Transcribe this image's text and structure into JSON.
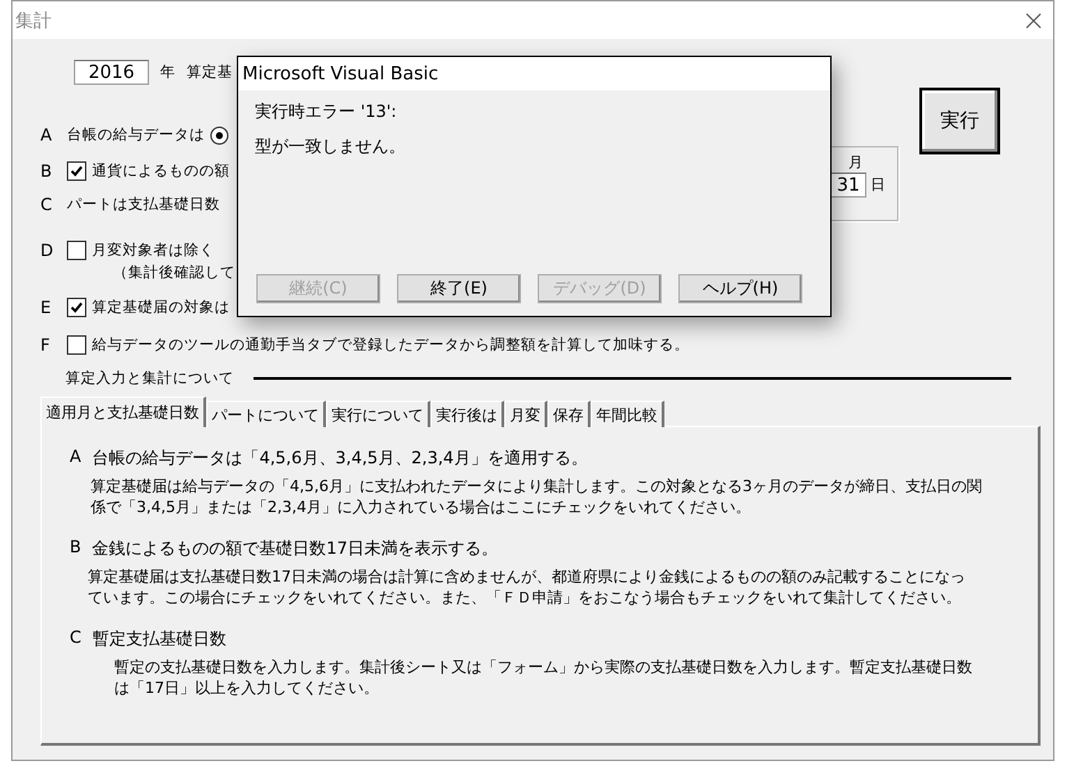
{
  "window": {
    "title": "集計"
  },
  "form": {
    "year": "2016",
    "year_label": "年",
    "base_label": "算定基",
    "execute": "実行",
    "options": [
      {
        "letter": "A",
        "kind": "radio",
        "label": "台帳の給与データは",
        "selected": true
      },
      {
        "letter": "B",
        "kind": "checkbox",
        "label": "通貨によるものの額",
        "checked": true
      },
      {
        "letter": "C",
        "kind": "text",
        "label": "パートは支払基礎日数"
      },
      {
        "letter": "D",
        "kind": "checkbox",
        "label": "月変対象者は除く",
        "checked": false,
        "note": "（集計後確認して"
      },
      {
        "letter": "E",
        "kind": "checkbox",
        "label": "算定基礎届の対象は",
        "checked": true
      },
      {
        "letter": "F",
        "kind": "checkbox",
        "label": "給与データのツールの通勤手当タブで登録したデータから調整額を計算して加味する。",
        "checked": false
      }
    ],
    "group": {
      "month": "月",
      "day": "31",
      "day_unit": "日"
    }
  },
  "section": {
    "title": "算定入力と集計について"
  },
  "tabs": [
    {
      "label": "適用月と支払基礎日数",
      "selected": true
    },
    {
      "label": "パートについて",
      "selected": false
    },
    {
      "label": "実行について",
      "selected": false
    },
    {
      "label": "実行後は",
      "selected": false
    },
    {
      "label": "月変",
      "selected": false
    },
    {
      "label": "保存",
      "selected": false
    },
    {
      "label": "年間比較",
      "selected": false
    }
  ],
  "panel": [
    {
      "letter": "A",
      "heading": "台帳の給与データは「4,5,6月、3,4,5月、2,3,4月」を適用する。",
      "body": "算定基礎届は給与データの「4,5,6月」に支払われたデータにより集計します。この対象となる3ヶ月のデータが締日、支払日の関係で「3,4,5月」または「2,3,4月」に入力されている場合はここにチェックをいれてください。"
    },
    {
      "letter": "B",
      "heading": "金銭によるものの額で基礎日数17日未満を表示する。",
      "body": "算定基礎届は支払基礎日数17日未満の場合は計算に含めませんが、都道府県により金銭によるものの額のみ記載することになっています。この場合にチェックをいれてください。また、「ＦＤ申請」をおこなう場合もチェックをいれて集計してください。"
    },
    {
      "letter": "C",
      "heading": "暫定支払基礎日数",
      "body": "暫定の支払基礎日数を入力します。集計後シート又は「フォーム」から実際の支払基礎日数を入力します。暫定支払基礎日数は「17日」以上を入力してください。"
    }
  ],
  "dialog": {
    "title": "Microsoft Visual Basic",
    "lines": [
      "実行時エラー '13':",
      "型が一致しません。"
    ],
    "buttons": [
      {
        "label": "継続(C)",
        "disabled": true
      },
      {
        "label": "終了(E)",
        "disabled": false
      },
      {
        "label": "デバッグ(D)",
        "disabled": true
      },
      {
        "label": "ヘルプ(H)",
        "disabled": false
      }
    ]
  }
}
